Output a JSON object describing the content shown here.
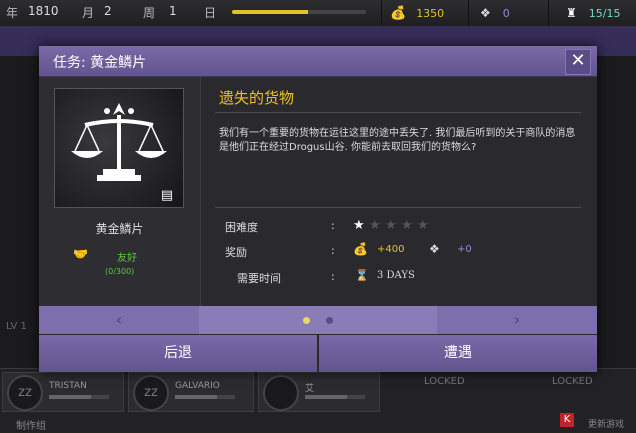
{
  "topbar": {
    "year_label": "年",
    "year_value": "1810",
    "month_label": "月",
    "month_value": "2",
    "week_label": "周",
    "week_value": "1",
    "day_label": "日",
    "day_progress": 0.57,
    "gold": "1350",
    "crystals": "0",
    "population": "15/15",
    "accent_gold": "#e2c028",
    "accent_crystal": "#9a86d4",
    "accent_pop": "#6fd9c6"
  },
  "background": {
    "units": [
      "TRISTAN",
      "GALVARIO",
      "艾"
    ],
    "level": "LV 1",
    "locked": [
      "LOCKED",
      "LOCKED"
    ],
    "bottom_tab": "制作组",
    "bottom_right": "更新游戏",
    "red_badge": "K"
  },
  "modal": {
    "title": "任务: 黄金鳞片",
    "close_icon": "close-icon",
    "left": {
      "name": "黄金鳞片",
      "relation_label": "友好",
      "relation_value": "(0/300)",
      "relation_icon": "handshake-icon"
    },
    "quest": {
      "title": "遗失的货物",
      "description": "我们有一个重要的货物在运往这里的途中丢失了. 我们最后听到的关于商队的消息是他们正在经过Drogus山谷. 你能前去取回我们的货物么?",
      "difficulty_label": "困难度",
      "difficulty_stars": 1,
      "difficulty_max": 5,
      "reward_label": "奖励",
      "reward_gold": "+400",
      "reward_crystal": "+0",
      "time_label": "需要时间",
      "time_value": "3 DAYS",
      "colon": ":"
    },
    "nav": {
      "prev": "‹",
      "next": "›",
      "page": 1,
      "pages": 2
    },
    "buttons": {
      "back": "后退",
      "go": "遭遇"
    }
  }
}
